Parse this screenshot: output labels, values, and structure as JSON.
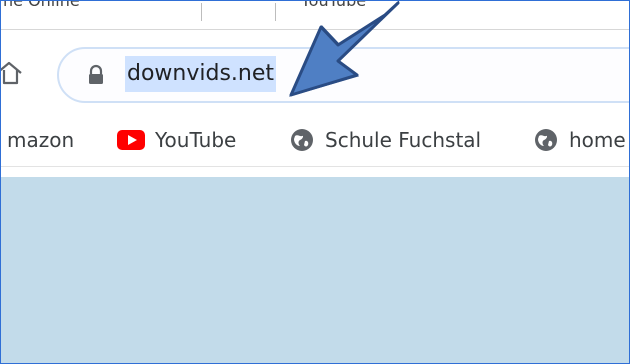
{
  "tab_strip": {
    "left_title_fragment": "ne Online",
    "right_title_fragment": "YouTube"
  },
  "omnibox": {
    "url": "downvids.net"
  },
  "bookmarks": [
    {
      "label": "mazon",
      "icon": "amazon"
    },
    {
      "label": "YouTube",
      "icon": "youtube-icon"
    },
    {
      "label": "Schule Fuchstal",
      "icon": "globe-icon"
    },
    {
      "label": "home",
      "icon": "globe-icon"
    }
  ],
  "colors": {
    "content_background": "#c2dbea",
    "url_highlight": "#cfe2ff",
    "arrow_fill": "#4f7fc4",
    "arrow_stroke": "#2a4c84"
  }
}
